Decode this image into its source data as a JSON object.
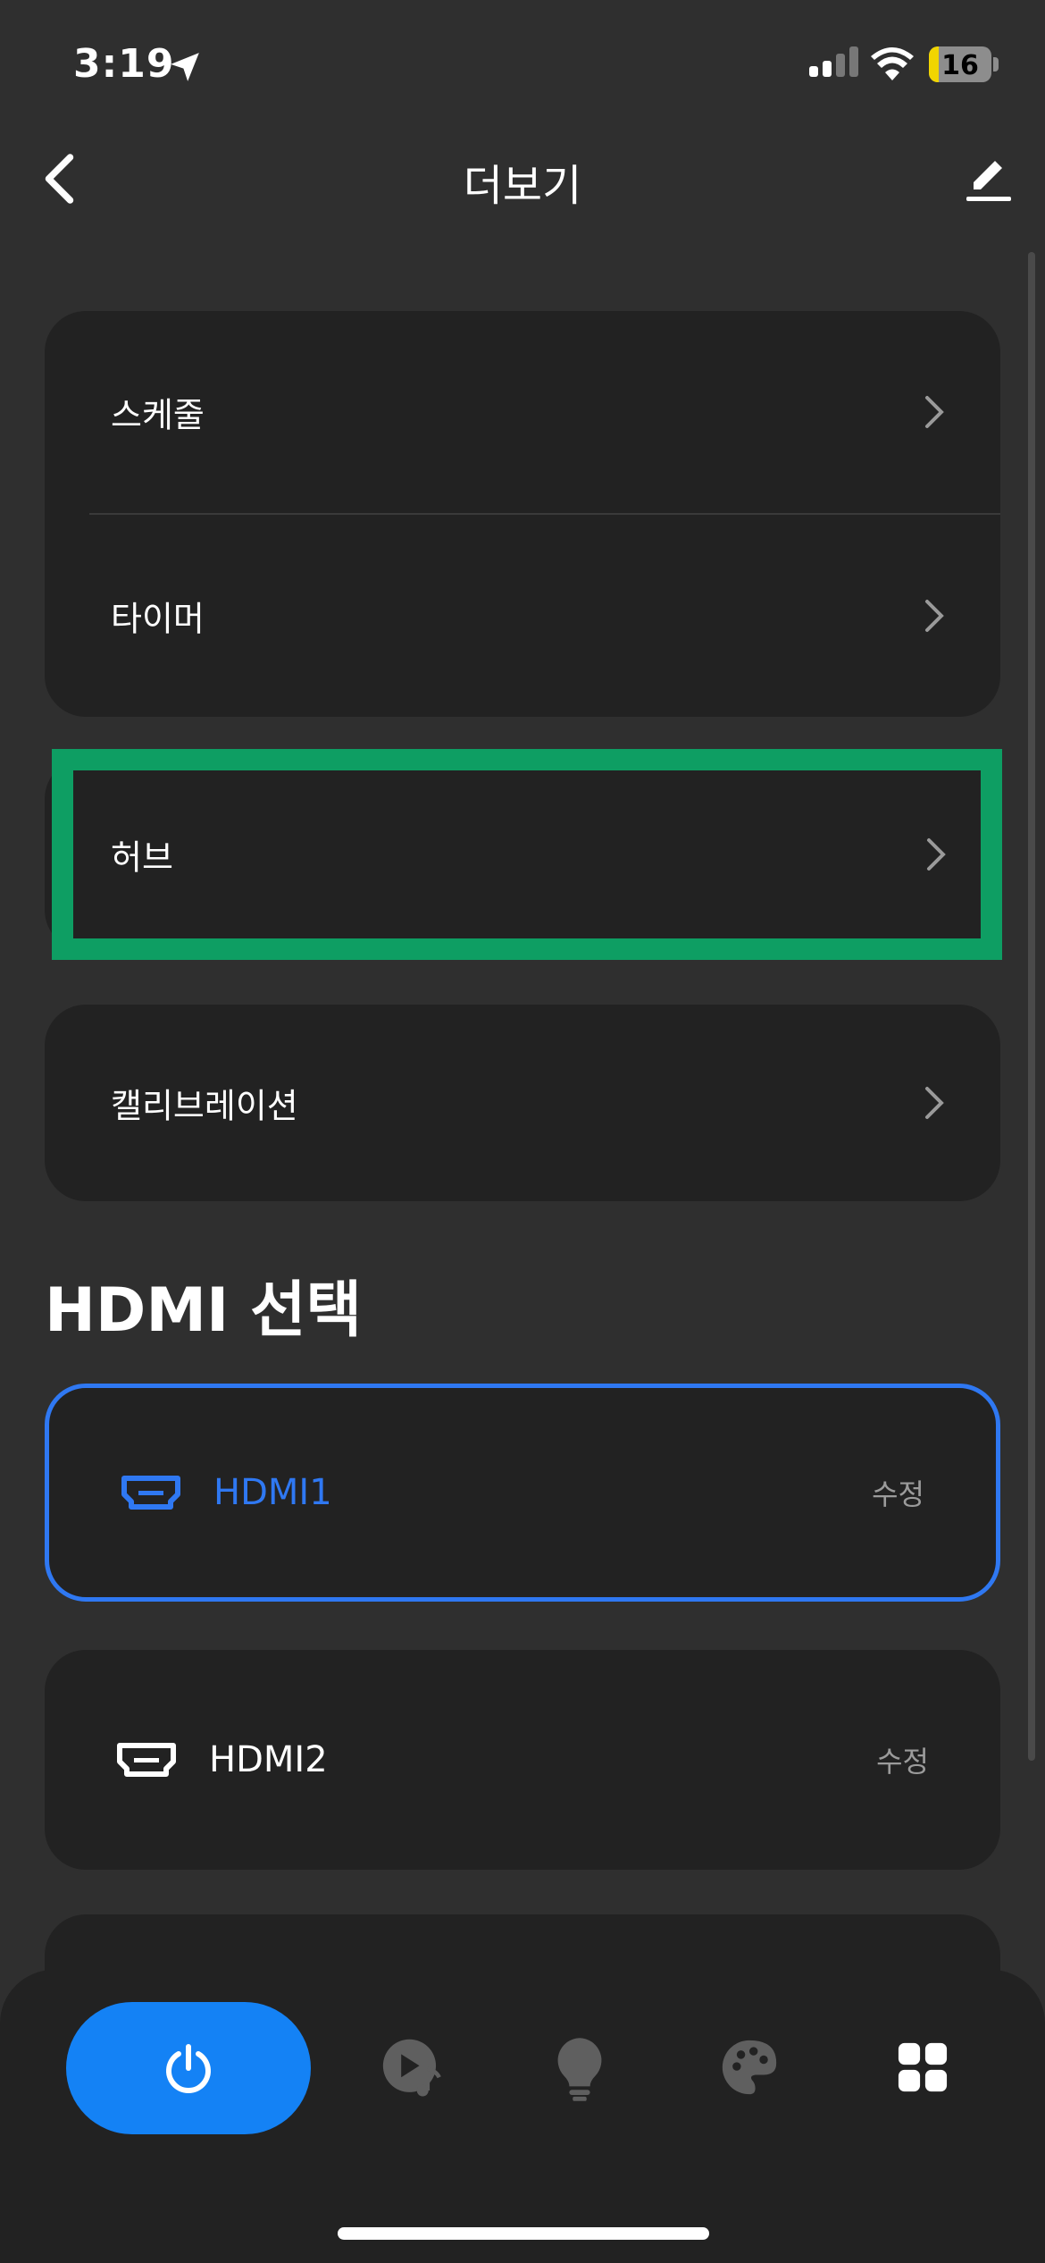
{
  "status_bar": {
    "time": "3:19",
    "battery": "16"
  },
  "header": {
    "title": "더보기"
  },
  "menu_group": {
    "items": [
      {
        "label": "스케줄"
      },
      {
        "label": "타이머"
      }
    ]
  },
  "hub": {
    "label": "허브"
  },
  "calibration": {
    "label": "캘리브레이션"
  },
  "hdmi_section": {
    "title": "HDMI 선택",
    "items": [
      {
        "label": "HDMI1",
        "edit": "수정",
        "selected": true
      },
      {
        "label": "HDMI2",
        "edit": "수정",
        "selected": false
      }
    ]
  },
  "bottom_nav": {
    "items": [
      {
        "icon": "power-icon",
        "active": true
      },
      {
        "icon": "music-play-icon"
      },
      {
        "icon": "lightbulb-icon"
      },
      {
        "icon": "palette-icon"
      },
      {
        "icon": "grid-icon"
      }
    ]
  },
  "colors": {
    "accent": "#1482f5",
    "selected_border": "#2f78f2",
    "highlight": "#0e9e63",
    "card": "#222222",
    "background": "#2f2f2f"
  }
}
